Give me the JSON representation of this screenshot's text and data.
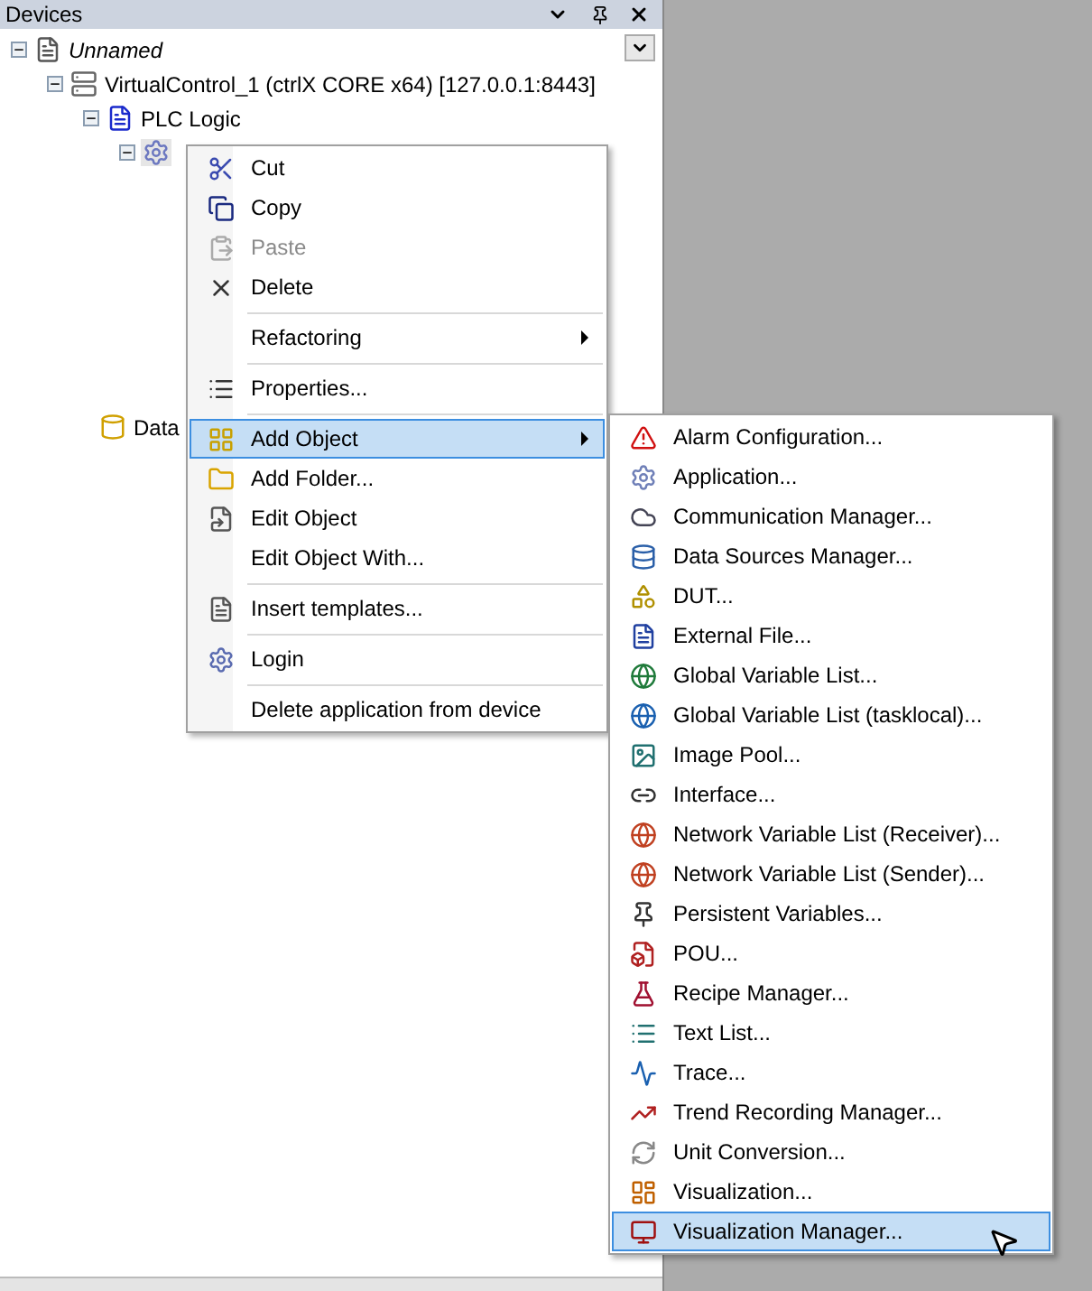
{
  "panel": {
    "title": "Devices"
  },
  "tree": [
    {
      "label": "Unnamed",
      "italic": true,
      "expanded": true,
      "children": [
        {
          "label": "VirtualControl_1 (ctrlX CORE x64) [127.0.0.1:8443]",
          "italic": false,
          "expanded": true,
          "children": [
            {
              "label": "PLC Logic",
              "italic": false,
              "expanded": true,
              "children": [
                {
                  "expanded": true,
                  "selected": true
                },
                {
                  "label": "Data",
                  "italic": false
                }
              ]
            }
          ]
        }
      ]
    }
  ],
  "context_menu": [
    {
      "kind": "item",
      "label": "Cut",
      "disabled": false,
      "selected": false
    },
    {
      "kind": "item",
      "label": "Copy",
      "disabled": false,
      "selected": false
    },
    {
      "kind": "item",
      "label": "Paste",
      "disabled": true,
      "selected": false
    },
    {
      "kind": "item",
      "label": "Delete",
      "disabled": false,
      "selected": false
    },
    {
      "kind": "separator"
    },
    {
      "kind": "item",
      "label": "Refactoring",
      "disabled": false,
      "selected": false,
      "submenu": true
    },
    {
      "kind": "separator"
    },
    {
      "kind": "item",
      "label": "Properties...",
      "disabled": false,
      "selected": false
    },
    {
      "kind": "separator"
    },
    {
      "kind": "item",
      "label": "Add Object",
      "disabled": false,
      "selected": true,
      "submenu": true
    },
    {
      "kind": "item",
      "label": "Add Folder...",
      "disabled": false,
      "selected": false
    },
    {
      "kind": "item",
      "label": "Edit Object",
      "disabled": false,
      "selected": false
    },
    {
      "kind": "item",
      "label": "Edit Object With...",
      "disabled": false,
      "selected": false
    },
    {
      "kind": "separator"
    },
    {
      "kind": "item",
      "label": "Insert templates...",
      "disabled": false,
      "selected": false
    },
    {
      "kind": "separator"
    },
    {
      "kind": "item",
      "label": "Login",
      "disabled": false,
      "selected": false
    },
    {
      "kind": "separator"
    },
    {
      "kind": "item",
      "label": "Delete application from device",
      "disabled": false,
      "selected": false
    }
  ],
  "submenu": [
    {
      "label": "Alarm Configuration...",
      "selected": false
    },
    {
      "label": "Application...",
      "selected": false
    },
    {
      "label": "Communication Manager...",
      "selected": false
    },
    {
      "label": "Data Sources Manager...",
      "selected": false
    },
    {
      "label": "DUT...",
      "selected": false
    },
    {
      "label": "External File...",
      "selected": false
    },
    {
      "label": "Global Variable List...",
      "selected": false
    },
    {
      "label": "Global Variable List (tasklocal)...",
      "selected": false
    },
    {
      "label": "Image Pool...",
      "selected": false
    },
    {
      "label": "Interface...",
      "selected": false
    },
    {
      "label": "Network Variable List (Receiver)...",
      "selected": false
    },
    {
      "label": "Network Variable List (Sender)...",
      "selected": false
    },
    {
      "label": "Persistent Variables...",
      "selected": false
    },
    {
      "label": "POU...",
      "selected": false
    },
    {
      "label": "Recipe Manager...",
      "selected": false
    },
    {
      "label": "Text List...",
      "selected": false
    },
    {
      "label": "Trace...",
      "selected": false
    },
    {
      "label": "Trend Recording Manager...",
      "selected": false
    },
    {
      "label": "Unit Conversion...",
      "selected": false
    },
    {
      "label": "Visualization...",
      "selected": false
    },
    {
      "label": "Visualization Manager...",
      "selected": true
    }
  ]
}
